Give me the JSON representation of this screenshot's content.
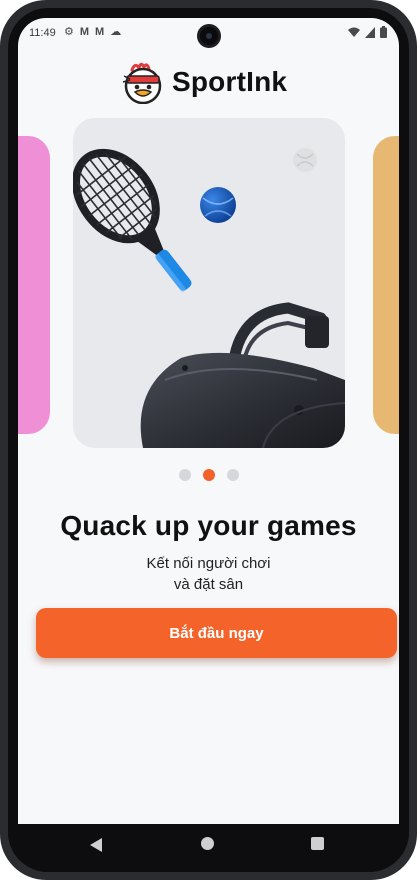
{
  "status_bar": {
    "time": "11:49",
    "left_icons": [
      "gear-icon",
      "gmail-icon",
      "gmail-icon",
      "cloud-icon"
    ],
    "right_icons": [
      "wifi-icon",
      "signal-icon",
      "battery-icon"
    ]
  },
  "brand": {
    "name": "SportInk",
    "logo": "duck-mascot-icon"
  },
  "carousel": {
    "cards": [
      {
        "position": "left",
        "color": "#ef90d6"
      },
      {
        "position": "center",
        "color": "#e8e9ec",
        "art": "tennis-racket-ball-bag"
      },
      {
        "position": "right",
        "color": "#e6b872"
      }
    ],
    "active_index": 1,
    "dot_count": 3
  },
  "onboarding": {
    "headline": "Quack up your games",
    "subtitle_line1": "Kết nối người chơi",
    "subtitle_line2": "và đặt sân"
  },
  "cta": {
    "label": "Bắt đầu ngay"
  },
  "colors": {
    "accent": "#f46329",
    "dot_inactive": "#d6d7db",
    "background": "#f7f8fa"
  },
  "nav_bar": {
    "buttons": [
      "back-icon",
      "home-icon",
      "recents-icon"
    ]
  }
}
